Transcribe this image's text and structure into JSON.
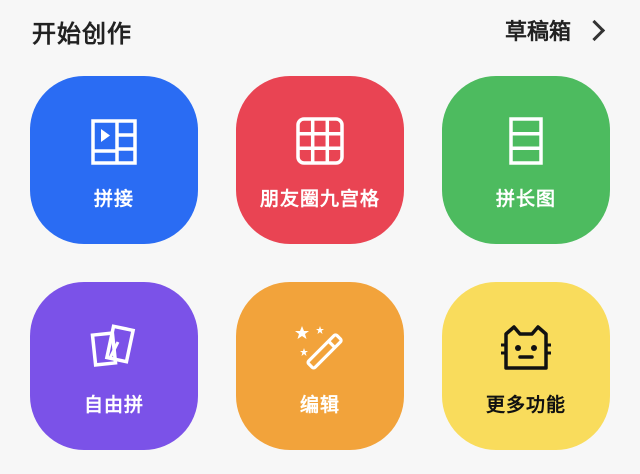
{
  "header": {
    "title": "开始创作",
    "drafts_label": "草稿箱"
  },
  "tiles": [
    {
      "label": "拼接",
      "icon": "video-collage-icon",
      "color": "#2a6cf3"
    },
    {
      "label": "朋友圈九宫格",
      "icon": "nine-grid-icon",
      "color": "#e94453"
    },
    {
      "label": "拼长图",
      "icon": "long-image-icon",
      "color": "#4dbb5f"
    },
    {
      "label": "自由拼",
      "icon": "free-collage-icon",
      "color": "#7b52e8"
    },
    {
      "label": "编辑",
      "icon": "magic-wand-icon",
      "color": "#f2a33b"
    },
    {
      "label": "更多功能",
      "icon": "cat-face-icon",
      "color": "#f9dc5c"
    }
  ]
}
